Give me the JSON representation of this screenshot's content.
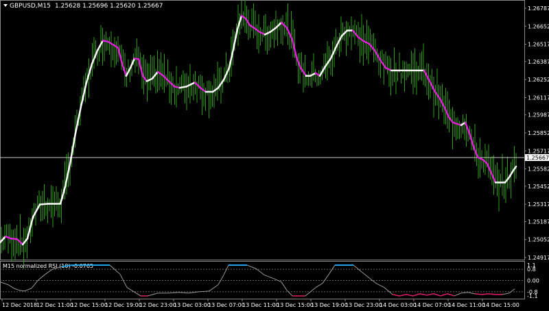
{
  "header": {
    "symbol_timeframe": "GBPUSD,M15",
    "ohlc": "1.25628 1.25696 1.25620 1.25667",
    "menu_icon": "triangle-down-icon"
  },
  "price_axis": {
    "labels": [
      "1.26787",
      "1.26652",
      "1.26517",
      "1.26387",
      "1.26252",
      "1.26117",
      "1.25987",
      "1.25852",
      "1.25717",
      "1.25582",
      "1.25452",
      "1.25317",
      "1.25187",
      "1.25052",
      "1.24917"
    ],
    "current_price": "1.25667"
  },
  "indicator": {
    "title": "M15 normalized RSI (10) -0.0765",
    "axis_labels": [
      "1.1",
      "0.8",
      "0.00",
      "-0.8",
      "-1.1"
    ]
  },
  "time_axis": {
    "labels": [
      "12 Dec 2018",
      "12 Dec 11:00",
      "12 Dec 15:00",
      "12 Dec 19:00",
      "12 Dec 23:00",
      "13 Dec 03:00",
      "13 Dec 07:00",
      "13 Dec 11:00",
      "13 Dec 15:00",
      "13 Dec 19:00",
      "13 Dec 23:00",
      "14 Dec 03:00",
      "14 Dec 07:00",
      "14 Dec 11:00",
      "14 Dec 15:00"
    ]
  },
  "colors": {
    "background": "#000000",
    "bars": "#2e9e1a",
    "ma_up": "#ffffff",
    "ma_down": "#e020d8",
    "rsi_high": "#1fa2e8",
    "rsi_low": "#e0206a",
    "rsi_mid": "#9a9a9a",
    "grid": "#8a8a8a"
  },
  "chart_data": {
    "type": "line",
    "price_range": [
      1.24917,
      1.26787
    ],
    "ma_path": [
      [
        0,
        1.2503
      ],
      [
        8,
        1.25075
      ],
      [
        16,
        1.2506
      ],
      [
        25,
        1.25055
      ],
      [
        33,
        1.25015
      ],
      [
        40,
        1.2506
      ],
      [
        48,
        1.2522
      ],
      [
        58,
        1.25315
      ],
      [
        70,
        1.2532
      ],
      [
        88,
        1.2532
      ],
      [
        95,
        1.2545
      ],
      [
        102,
        1.2562
      ],
      [
        110,
        1.2585
      ],
      [
        118,
        1.2605
      ],
      [
        126,
        1.2623
      ],
      [
        134,
        1.2637
      ],
      [
        142,
        1.2647
      ],
      [
        150,
        1.26545
      ],
      [
        158,
        1.26535
      ],
      [
        166,
        1.2651
      ],
      [
        172,
        1.2649
      ],
      [
        178,
        1.2637
      ],
      [
        184,
        1.2628
      ],
      [
        190,
        1.2634
      ],
      [
        196,
        1.2641
      ],
      [
        202,
        1.26405
      ],
      [
        208,
        1.2628
      ],
      [
        214,
        1.2624
      ],
      [
        222,
        1.2626
      ],
      [
        230,
        1.2631
      ],
      [
        238,
        1.2628
      ],
      [
        246,
        1.2624
      ],
      [
        254,
        1.262
      ],
      [
        262,
        1.2619
      ],
      [
        272,
        1.262
      ],
      [
        284,
        1.2623
      ],
      [
        292,
        1.2619
      ],
      [
        300,
        1.2616
      ],
      [
        310,
        1.2616
      ],
      [
        318,
        1.2619
      ],
      [
        326,
        1.2625
      ],
      [
        334,
        1.2634
      ],
      [
        340,
        1.2648
      ],
      [
        346,
        1.2663
      ],
      [
        352,
        1.2673
      ],
      [
        358,
        1.2671
      ],
      [
        364,
        1.2666
      ],
      [
        370,
        1.2664
      ],
      [
        378,
        1.2661
      ],
      [
        386,
        1.2659
      ],
      [
        394,
        1.2661
      ],
      [
        402,
        1.2664
      ],
      [
        410,
        1.2668
      ],
      [
        418,
        1.2664
      ],
      [
        426,
        1.2655
      ],
      [
        432,
        1.2642
      ],
      [
        438,
        1.2634
      ],
      [
        446,
        1.2628
      ],
      [
        452,
        1.2628
      ],
      [
        460,
        1.263
      ],
      [
        466,
        1.2628
      ],
      [
        474,
        1.2635
      ],
      [
        482,
        1.2641
      ],
      [
        490,
        1.265
      ],
      [
        498,
        1.2658
      ],
      [
        506,
        1.2662
      ],
      [
        514,
        1.2662
      ],
      [
        522,
        1.2657
      ],
      [
        530,
        1.2654
      ],
      [
        538,
        1.2652
      ],
      [
        546,
        1.2647
      ],
      [
        554,
        1.264
      ],
      [
        562,
        1.2634
      ],
      [
        570,
        1.2632
      ],
      [
        580,
        1.2632
      ],
      [
        592,
        1.2632
      ],
      [
        606,
        1.2632
      ],
      [
        618,
        1.2632
      ],
      [
        626,
        1.2624
      ],
      [
        634,
        1.2616
      ],
      [
        642,
        1.261
      ],
      [
        648,
        1.2604
      ],
      [
        654,
        1.2597
      ],
      [
        660,
        1.2593
      ],
      [
        666,
        1.2592
      ],
      [
        672,
        1.2591
      ],
      [
        678,
        1.2593
      ],
      [
        684,
        1.2585
      ],
      [
        690,
        1.2575
      ],
      [
        696,
        1.2567
      ],
      [
        704,
        1.2565
      ],
      [
        710,
        1.2562
      ],
      [
        716,
        1.2555
      ],
      [
        722,
        1.2548
      ],
      [
        728,
        1.2548
      ],
      [
        736,
        1.2548
      ],
      [
        742,
        1.2552
      ],
      [
        748,
        1.2557
      ],
      [
        752,
        1.256
      ]
    ],
    "rsi_path": [
      [
        0,
        -0.1
      ],
      [
        12,
        -0.3
      ],
      [
        20,
        -0.55
      ],
      [
        28,
        -0.7
      ],
      [
        36,
        -0.75
      ],
      [
        46,
        -0.55
      ],
      [
        56,
        0.05
      ],
      [
        66,
        0.45
      ],
      [
        76,
        0.8
      ],
      [
        90,
        1.0
      ],
      [
        105,
        1.1
      ],
      [
        120,
        1.1
      ],
      [
        140,
        1.1
      ],
      [
        160,
        1.1
      ],
      [
        175,
        0.45
      ],
      [
        185,
        -0.5
      ],
      [
        195,
        -0.8
      ],
      [
        205,
        -1.1
      ],
      [
        215,
        -1.1
      ],
      [
        230,
        -0.9
      ],
      [
        245,
        -0.9
      ],
      [
        260,
        -0.85
      ],
      [
        275,
        -0.9
      ],
      [
        290,
        -0.8
      ],
      [
        305,
        -0.75
      ],
      [
        318,
        -0.3
      ],
      [
        326,
        0.4
      ],
      [
        333,
        1.1
      ],
      [
        345,
        1.1
      ],
      [
        360,
        1.1
      ],
      [
        373,
        0.85
      ],
      [
        385,
        0.4
      ],
      [
        398,
        0.15
      ],
      [
        410,
        -0.1
      ],
      [
        418,
        -0.7
      ],
      [
        426,
        -1.1
      ],
      [
        445,
        -1.1
      ],
      [
        460,
        -0.5
      ],
      [
        470,
        -0.2
      ],
      [
        480,
        0.5
      ],
      [
        488,
        1.1
      ],
      [
        500,
        1.1
      ],
      [
        515,
        1.1
      ],
      [
        525,
        0.7
      ],
      [
        535,
        0.3
      ],
      [
        548,
        -0.2
      ],
      [
        560,
        -0.5
      ],
      [
        572,
        -1.0
      ],
      [
        582,
        -1.1
      ],
      [
        592,
        -1.0
      ],
      [
        602,
        -1.1
      ],
      [
        612,
        -0.95
      ],
      [
        622,
        -1.05
      ],
      [
        632,
        -0.95
      ],
      [
        642,
        -1.1
      ],
      [
        652,
        -0.95
      ],
      [
        662,
        -1.1
      ],
      [
        672,
        -0.9
      ],
      [
        682,
        -0.85
      ],
      [
        692,
        -0.95
      ],
      [
        702,
        -1.0
      ],
      [
        712,
        -0.95
      ],
      [
        722,
        -1.0
      ],
      [
        732,
        -1.0
      ],
      [
        742,
        -0.9
      ],
      [
        750,
        -0.6
      ]
    ],
    "rsi_range": [
      -1.2,
      1.2
    ]
  }
}
